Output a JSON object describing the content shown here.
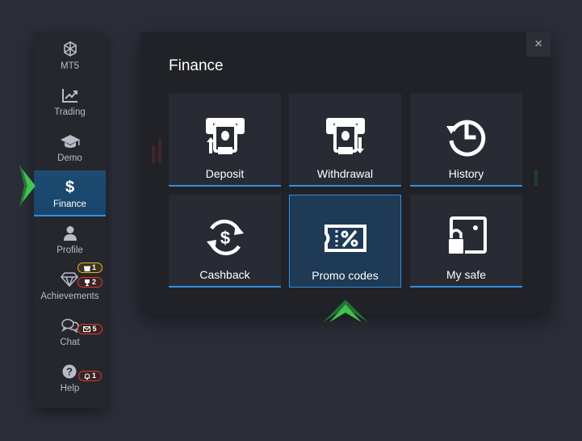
{
  "sidebar": {
    "items": [
      {
        "label": "MT5",
        "icon": "mt5-icon"
      },
      {
        "label": "Trading",
        "icon": "trend-up-icon"
      },
      {
        "label": "Demo",
        "icon": "graduation-cap-icon"
      },
      {
        "label": "Finance",
        "icon": "dollar-icon",
        "active": true
      },
      {
        "label": "Profile",
        "icon": "user-icon"
      },
      {
        "label": "Achievements",
        "icon": "diamond-icon"
      },
      {
        "label": "Chat",
        "icon": "chat-icon"
      },
      {
        "label": "Help",
        "icon": "help-icon"
      }
    ],
    "badges": {
      "achievements_gift": "1",
      "achievements_trophy": "2",
      "chat_mail": "5",
      "help_bell": "1"
    }
  },
  "modal": {
    "title": "Finance",
    "close_label": "×",
    "tiles": [
      {
        "label": "Deposit",
        "icon": "atm-deposit-icon"
      },
      {
        "label": "Withdrawal",
        "icon": "atm-withdrawal-icon"
      },
      {
        "label": "History",
        "icon": "history-clock-icon"
      },
      {
        "label": "Cashback",
        "icon": "cashback-icon"
      },
      {
        "label": "Promo codes",
        "icon": "coupon-percent-icon",
        "selected": true
      },
      {
        "label": "My safe",
        "icon": "safe-lock-icon"
      }
    ]
  },
  "colors": {
    "accent": "#2f8fe0",
    "active_arrow": "#3fc44f",
    "badge_yellow": "#e0b52a",
    "badge_red": "#d63b3b"
  }
}
